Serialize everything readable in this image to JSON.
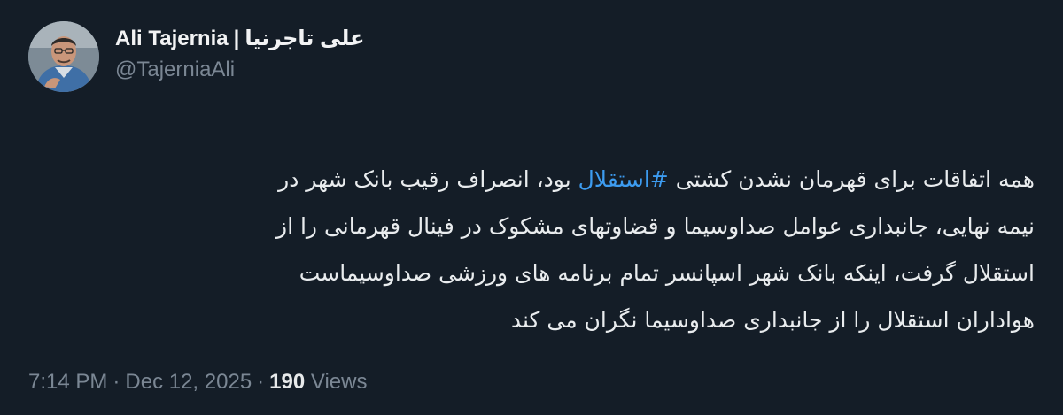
{
  "author": {
    "name": "Ali Tajernia",
    "separator": "|",
    "name_fa": "علی تاجرنیا",
    "handle": "@TajerniaAli"
  },
  "tweet": {
    "line1_before": "همه اتفاقات برای قهرمان نشدن کشتی ",
    "hashtag": "#استقلال",
    "line1_after": " بود، انصراف رقیب بانک شهر در",
    "line2": "نیمه نهایی، جانبداری عوامل صداوسیما و قضاوتهای مشکوک در فینال قهرمانی را از",
    "line3": "استقلال گرفت، اینکه بانک شهر اسپانسر تمام برنامه های ورزشی صداوسیماست",
    "line4": "هواداران استقلال را از جانبداری صداوسیما نگران می کند"
  },
  "meta": {
    "time": "7:14 PM",
    "date": "Dec 12, 2025",
    "views_count": "190",
    "views_label": "Views",
    "dot": "·"
  },
  "colors": {
    "background": "#141d27",
    "text": "#e9ecee",
    "secondary": "#7b8794",
    "link": "#3d9cf0"
  }
}
